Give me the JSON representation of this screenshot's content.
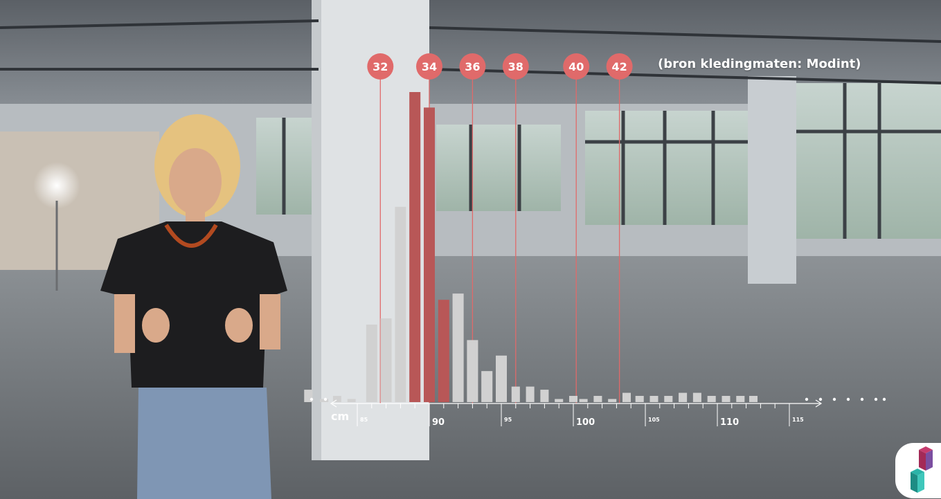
{
  "source_note": "(bron kledingmaten: Modint)",
  "colors": {
    "accent": "#e06a6a",
    "bar": "#ffffff",
    "text": "#ffffff",
    "floor": "#6f7378",
    "wall": "#b9bfc4"
  },
  "icons": {
    "light": "studio-light-icon",
    "logo": "logo-cubes-icon",
    "arrow": "arrow-left-icon"
  },
  "chart_data": {
    "type": "bar",
    "x_unit": "cm",
    "xlim": [
      80,
      120
    ],
    "x_ticks": [
      85,
      90,
      95,
      100,
      105,
      110,
      115
    ],
    "x_tick_labels": [
      "85",
      "90",
      "95",
      "100",
      "105",
      "110",
      "115"
    ],
    "size_markers": [
      {
        "label": "32",
        "x": 86.6
      },
      {
        "label": "34",
        "x": 90
      },
      {
        "label": "36",
        "x": 93
      },
      {
        "label": "38",
        "x": 96
      },
      {
        "label": "40",
        "x": 100.2
      },
      {
        "label": "42",
        "x": 103.2
      }
    ],
    "series": [
      {
        "x": [
          81.6,
          82.7,
          83.6,
          84.6,
          86,
          87,
          88,
          89,
          90,
          91,
          92,
          93,
          94,
          95,
          96,
          97,
          98,
          99,
          100,
          100.7,
          101.7,
          102.7,
          103.7,
          104.6,
          105.6,
          106.6,
          107.6,
          108.6,
          109.6,
          110.6,
          111.6,
          112.5
        ],
        "values": [
          4,
          1,
          2,
          1,
          25,
          27,
          63,
          100,
          95,
          33,
          35,
          20,
          10,
          15,
          5,
          5,
          4,
          1,
          2,
          1,
          2,
          1,
          3,
          2,
          2,
          2,
          3,
          3,
          2,
          2,
          2,
          2
        ],
        "highlighted": [
          false,
          false,
          false,
          false,
          false,
          false,
          false,
          true,
          true,
          true,
          false,
          false,
          false,
          false,
          false,
          false,
          false,
          false,
          false,
          false,
          false,
          false,
          false,
          false,
          false,
          false,
          false,
          false,
          false,
          false,
          false,
          false
        ]
      }
    ],
    "grid": false,
    "legend": "none"
  }
}
